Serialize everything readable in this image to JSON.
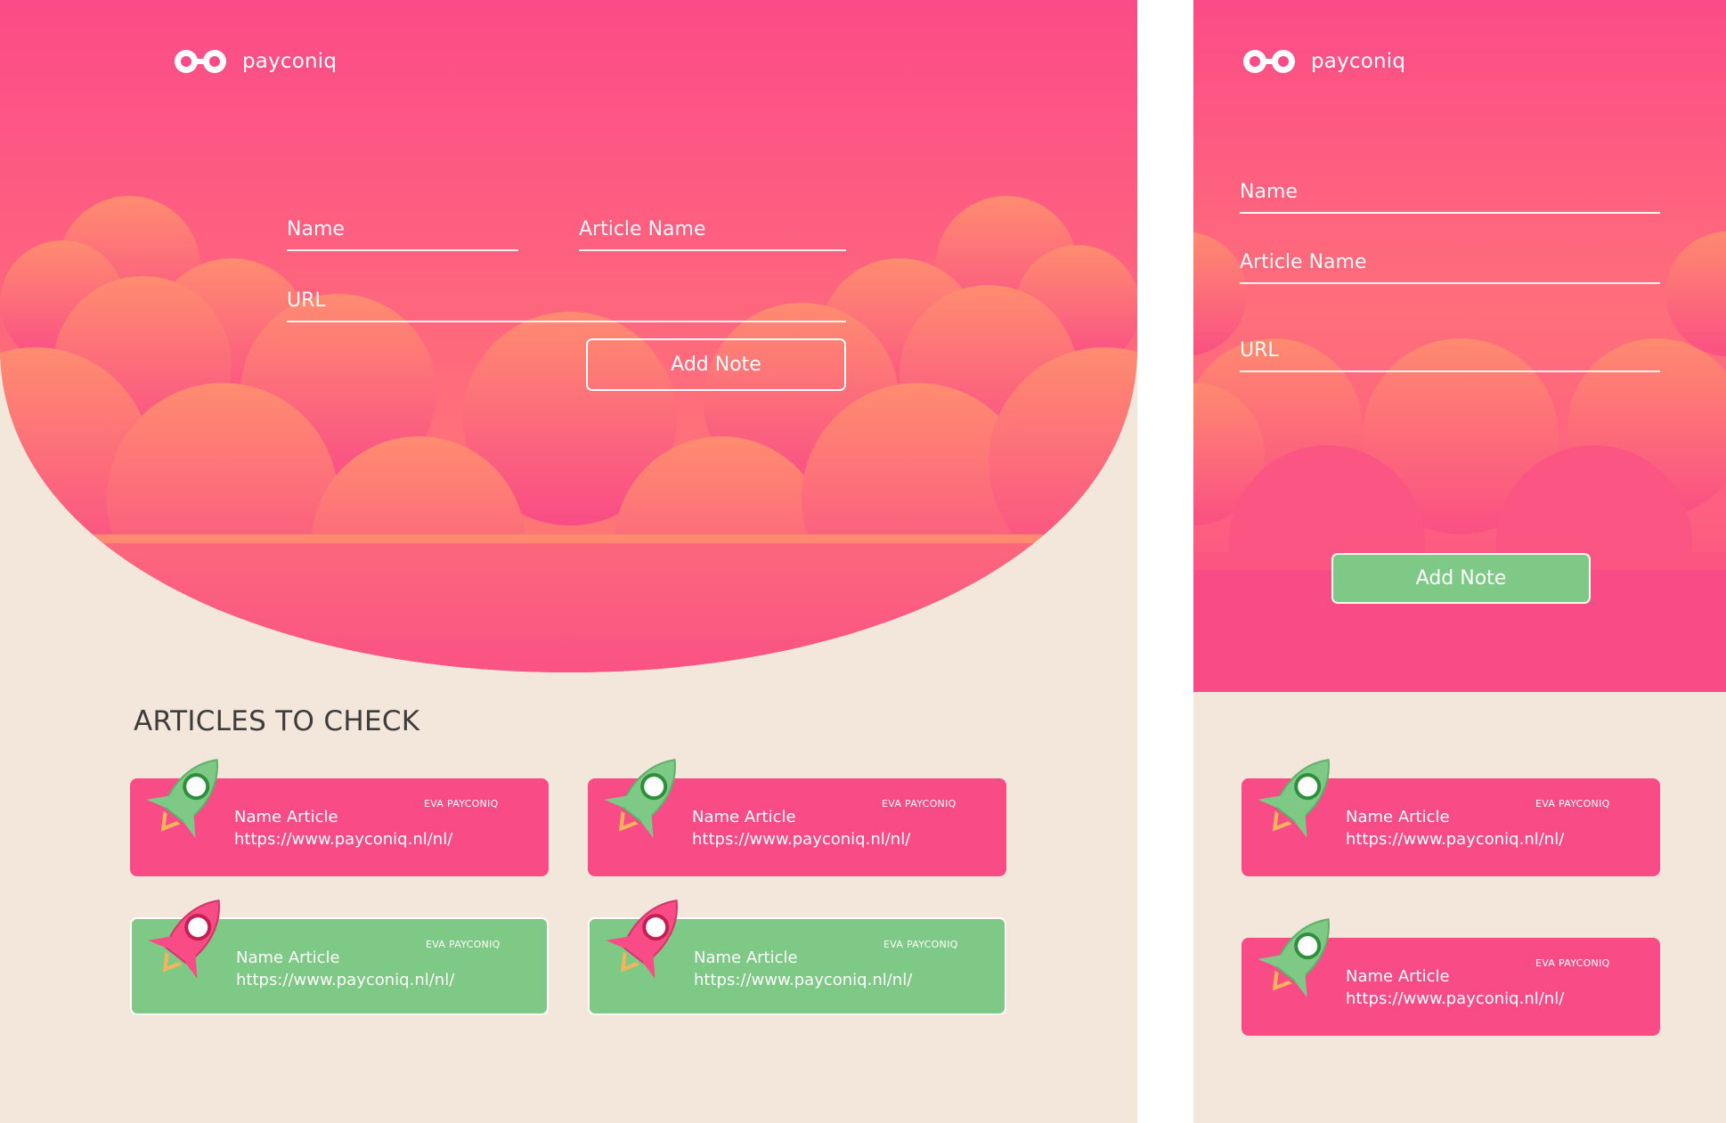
{
  "brand": {
    "name": "payconiq"
  },
  "form": {
    "name_placeholder": "Name",
    "article_placeholder": "Article Name",
    "url_placeholder": "URL",
    "add_note_label": "Add Note"
  },
  "articles": {
    "title": "ARTICLES TO CHECK",
    "items": [
      {
        "name": "Name Article",
        "url": "https://www.payconiq.nl/nl/",
        "author": "EVA PAYCONIQ"
      },
      {
        "name": "Name Article",
        "url": "https://www.payconiq.nl/nl/",
        "author": "EVA PAYCONIQ"
      },
      {
        "name": "Name Article",
        "url": "https://www.payconiq.nl/nl/",
        "author": "EVA PAYCONIQ"
      },
      {
        "name": "Name Article",
        "url": "https://www.payconiq.nl/nl/",
        "author": "EVA PAYCONIQ"
      }
    ]
  },
  "mobile": {
    "articles": [
      {
        "name": "Name Article",
        "url": "https://www.payconiq.nl/nl/",
        "author": "EVA PAYCONIQ"
      },
      {
        "name": "Name Article",
        "url": "https://www.payconiq.nl/nl/",
        "author": "EVA PAYCONIQ"
      }
    ]
  },
  "colors": {
    "pink": "#f94c86",
    "coral": "#ff7e73",
    "green": "#7fc986",
    "beige": "#f3e6db"
  }
}
